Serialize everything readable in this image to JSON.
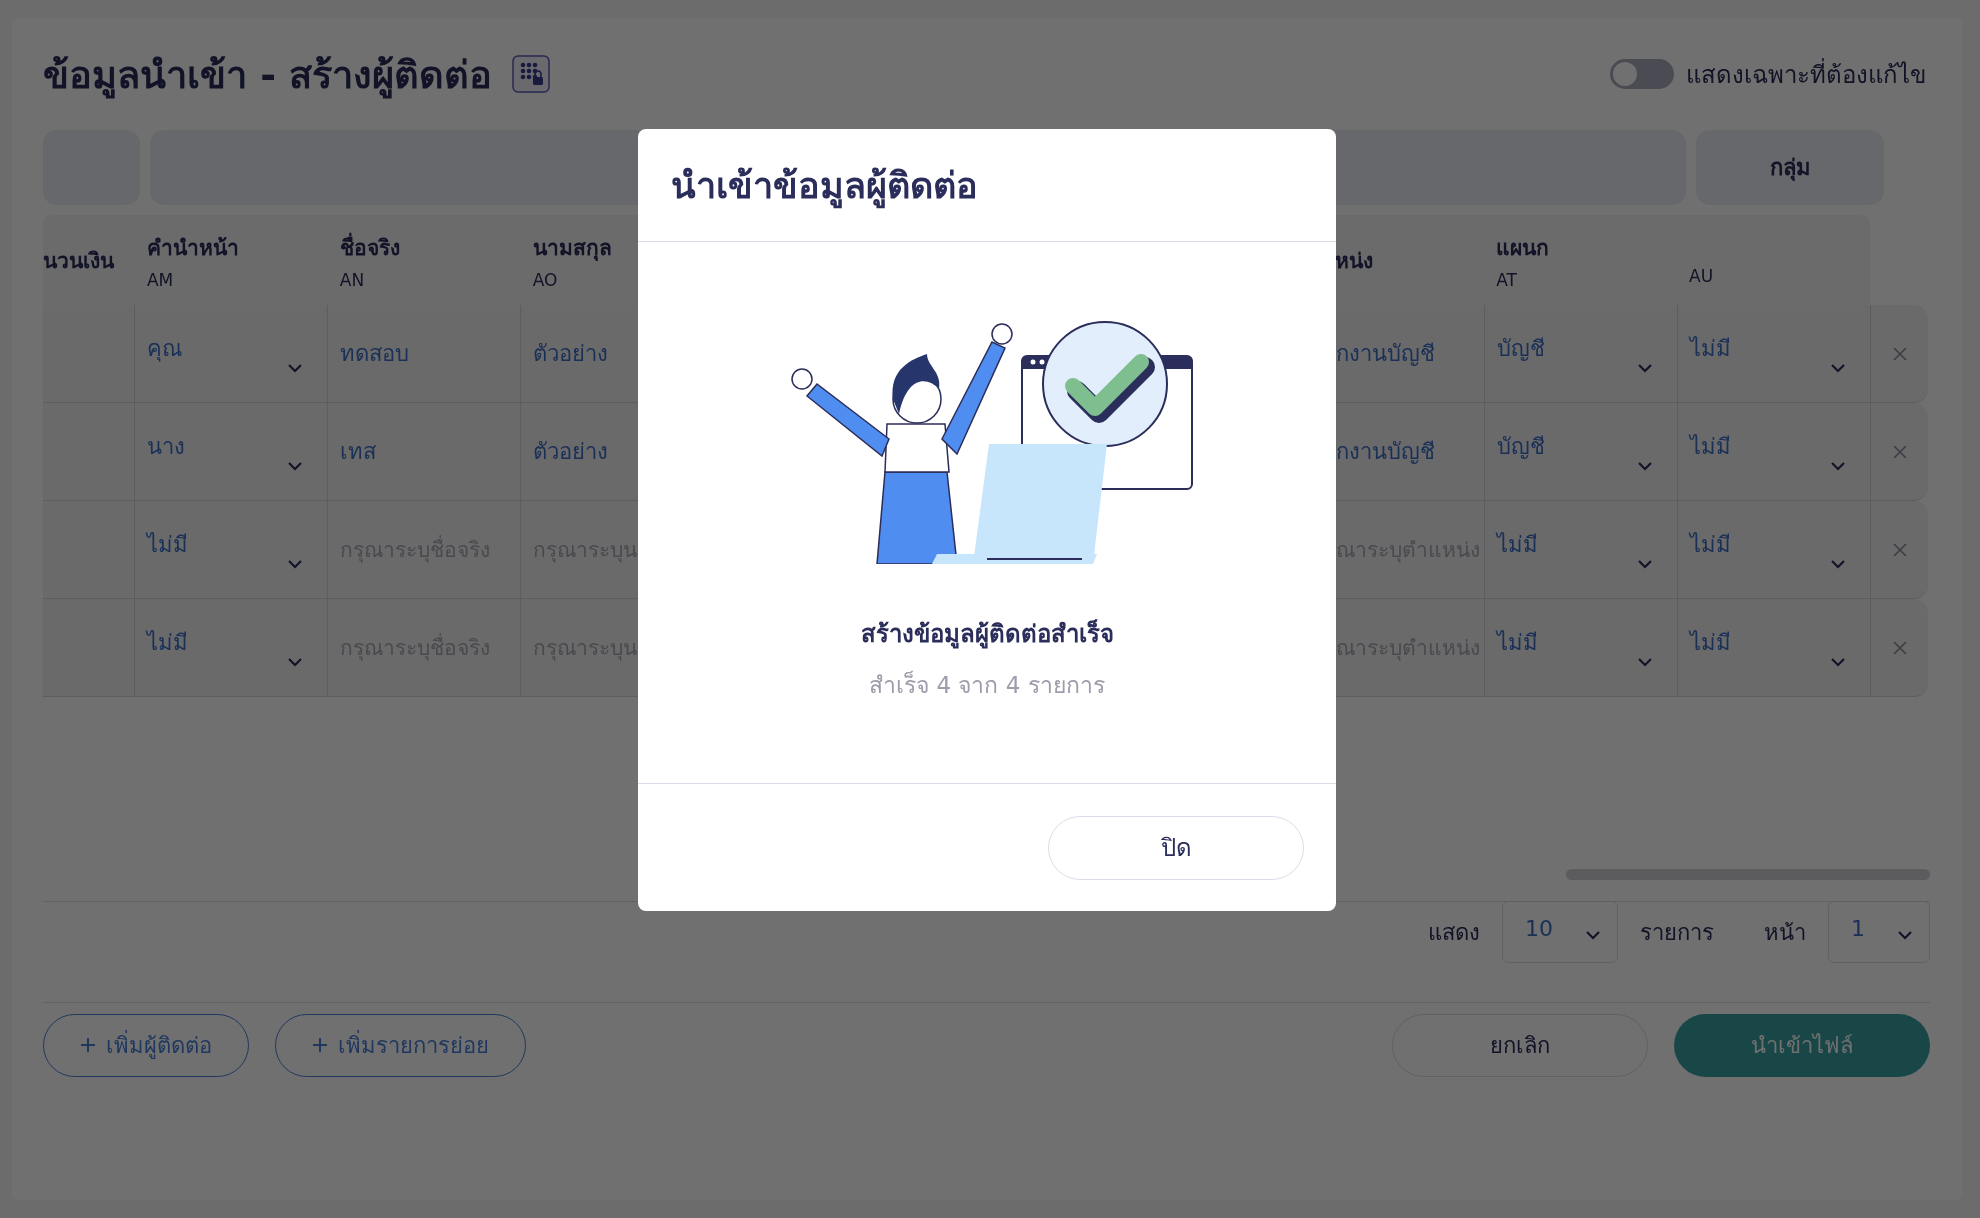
{
  "page": {
    "title": "ข้อมูลนำเข้า - สร้างผู้ติดต่อ",
    "toggle": {
      "label": "แสดงเฉพาะที่ต้องแก้ไข",
      "on": false
    }
  },
  "group_header": {
    "label": "กลุ่ม"
  },
  "columns": [
    {
      "kind": "blank",
      "label": "นวนเงิน"
    },
    {
      "kind": "select",
      "label": "คำนำหน้า",
      "letter": "AM"
    },
    {
      "kind": "text",
      "label": "ชื่อจริง",
      "letter": "AN"
    },
    {
      "kind": "text",
      "label": "นามสกุล",
      "letter": "AO"
    },
    {
      "kind": "cut",
      "label": "หน่ง"
    },
    {
      "kind": "select",
      "label": "แผนก",
      "letter": "AT"
    },
    {
      "kind": "select",
      "letter": "AU"
    }
  ],
  "rows": [
    {
      "cells": [
        {
          "value": "คุณ"
        },
        {
          "value": "ทดสอบ"
        },
        {
          "value": "ตัวอย่าง"
        },
        {
          "value": "กงานบัญชี"
        },
        {
          "value": "บัญชี"
        },
        {
          "value": "ไม่มี"
        }
      ]
    },
    {
      "cells": [
        {
          "value": "นาง"
        },
        {
          "value": "เทส"
        },
        {
          "value": "ตัวอย่าง"
        },
        {
          "value": "กงานบัญชี"
        },
        {
          "value": "บัญชี"
        },
        {
          "value": "ไม่มี"
        }
      ]
    },
    {
      "cells": [
        {
          "value": "ไม่มี"
        },
        {
          "placeholder": "กรุณาระบุชื่อจริง"
        },
        {
          "placeholder": "กรุณาระบุน"
        },
        {
          "placeholder": "ณาระบุตำแหน่ง"
        },
        {
          "value": "ไม่มี"
        },
        {
          "value": "ไม่มี"
        }
      ]
    },
    {
      "cells": [
        {
          "value": "ไม่มี"
        },
        {
          "placeholder": "กรุณาระบุชื่อจริง"
        },
        {
          "placeholder": "กรุณาระบุน"
        },
        {
          "placeholder": "ณาระบุตำแหน่ง"
        },
        {
          "value": "ไม่มี"
        },
        {
          "value": "ไม่มี"
        }
      ]
    }
  ],
  "pagination": {
    "show_label": "แสดง",
    "page_size": "10",
    "items_label": "รายการ",
    "page_label": "หน้า",
    "page": "1"
  },
  "add_buttons": [
    {
      "label": "เพิ่มผู้ติดต่อ"
    },
    {
      "label": "เพิ่มรายการย่อย"
    }
  ],
  "footer": {
    "cancel": "ยกเลิก",
    "submit": "นำเข้าไฟล์"
  },
  "modal": {
    "title": "นำเข้าข้อมูลผู้ติดต่อ",
    "message": "สร้างข้อมูลผู้ติดต่อสำเร็จ",
    "detail": "สำเร็จ 4 จาก 4 รายการ",
    "close": "ปิด"
  }
}
